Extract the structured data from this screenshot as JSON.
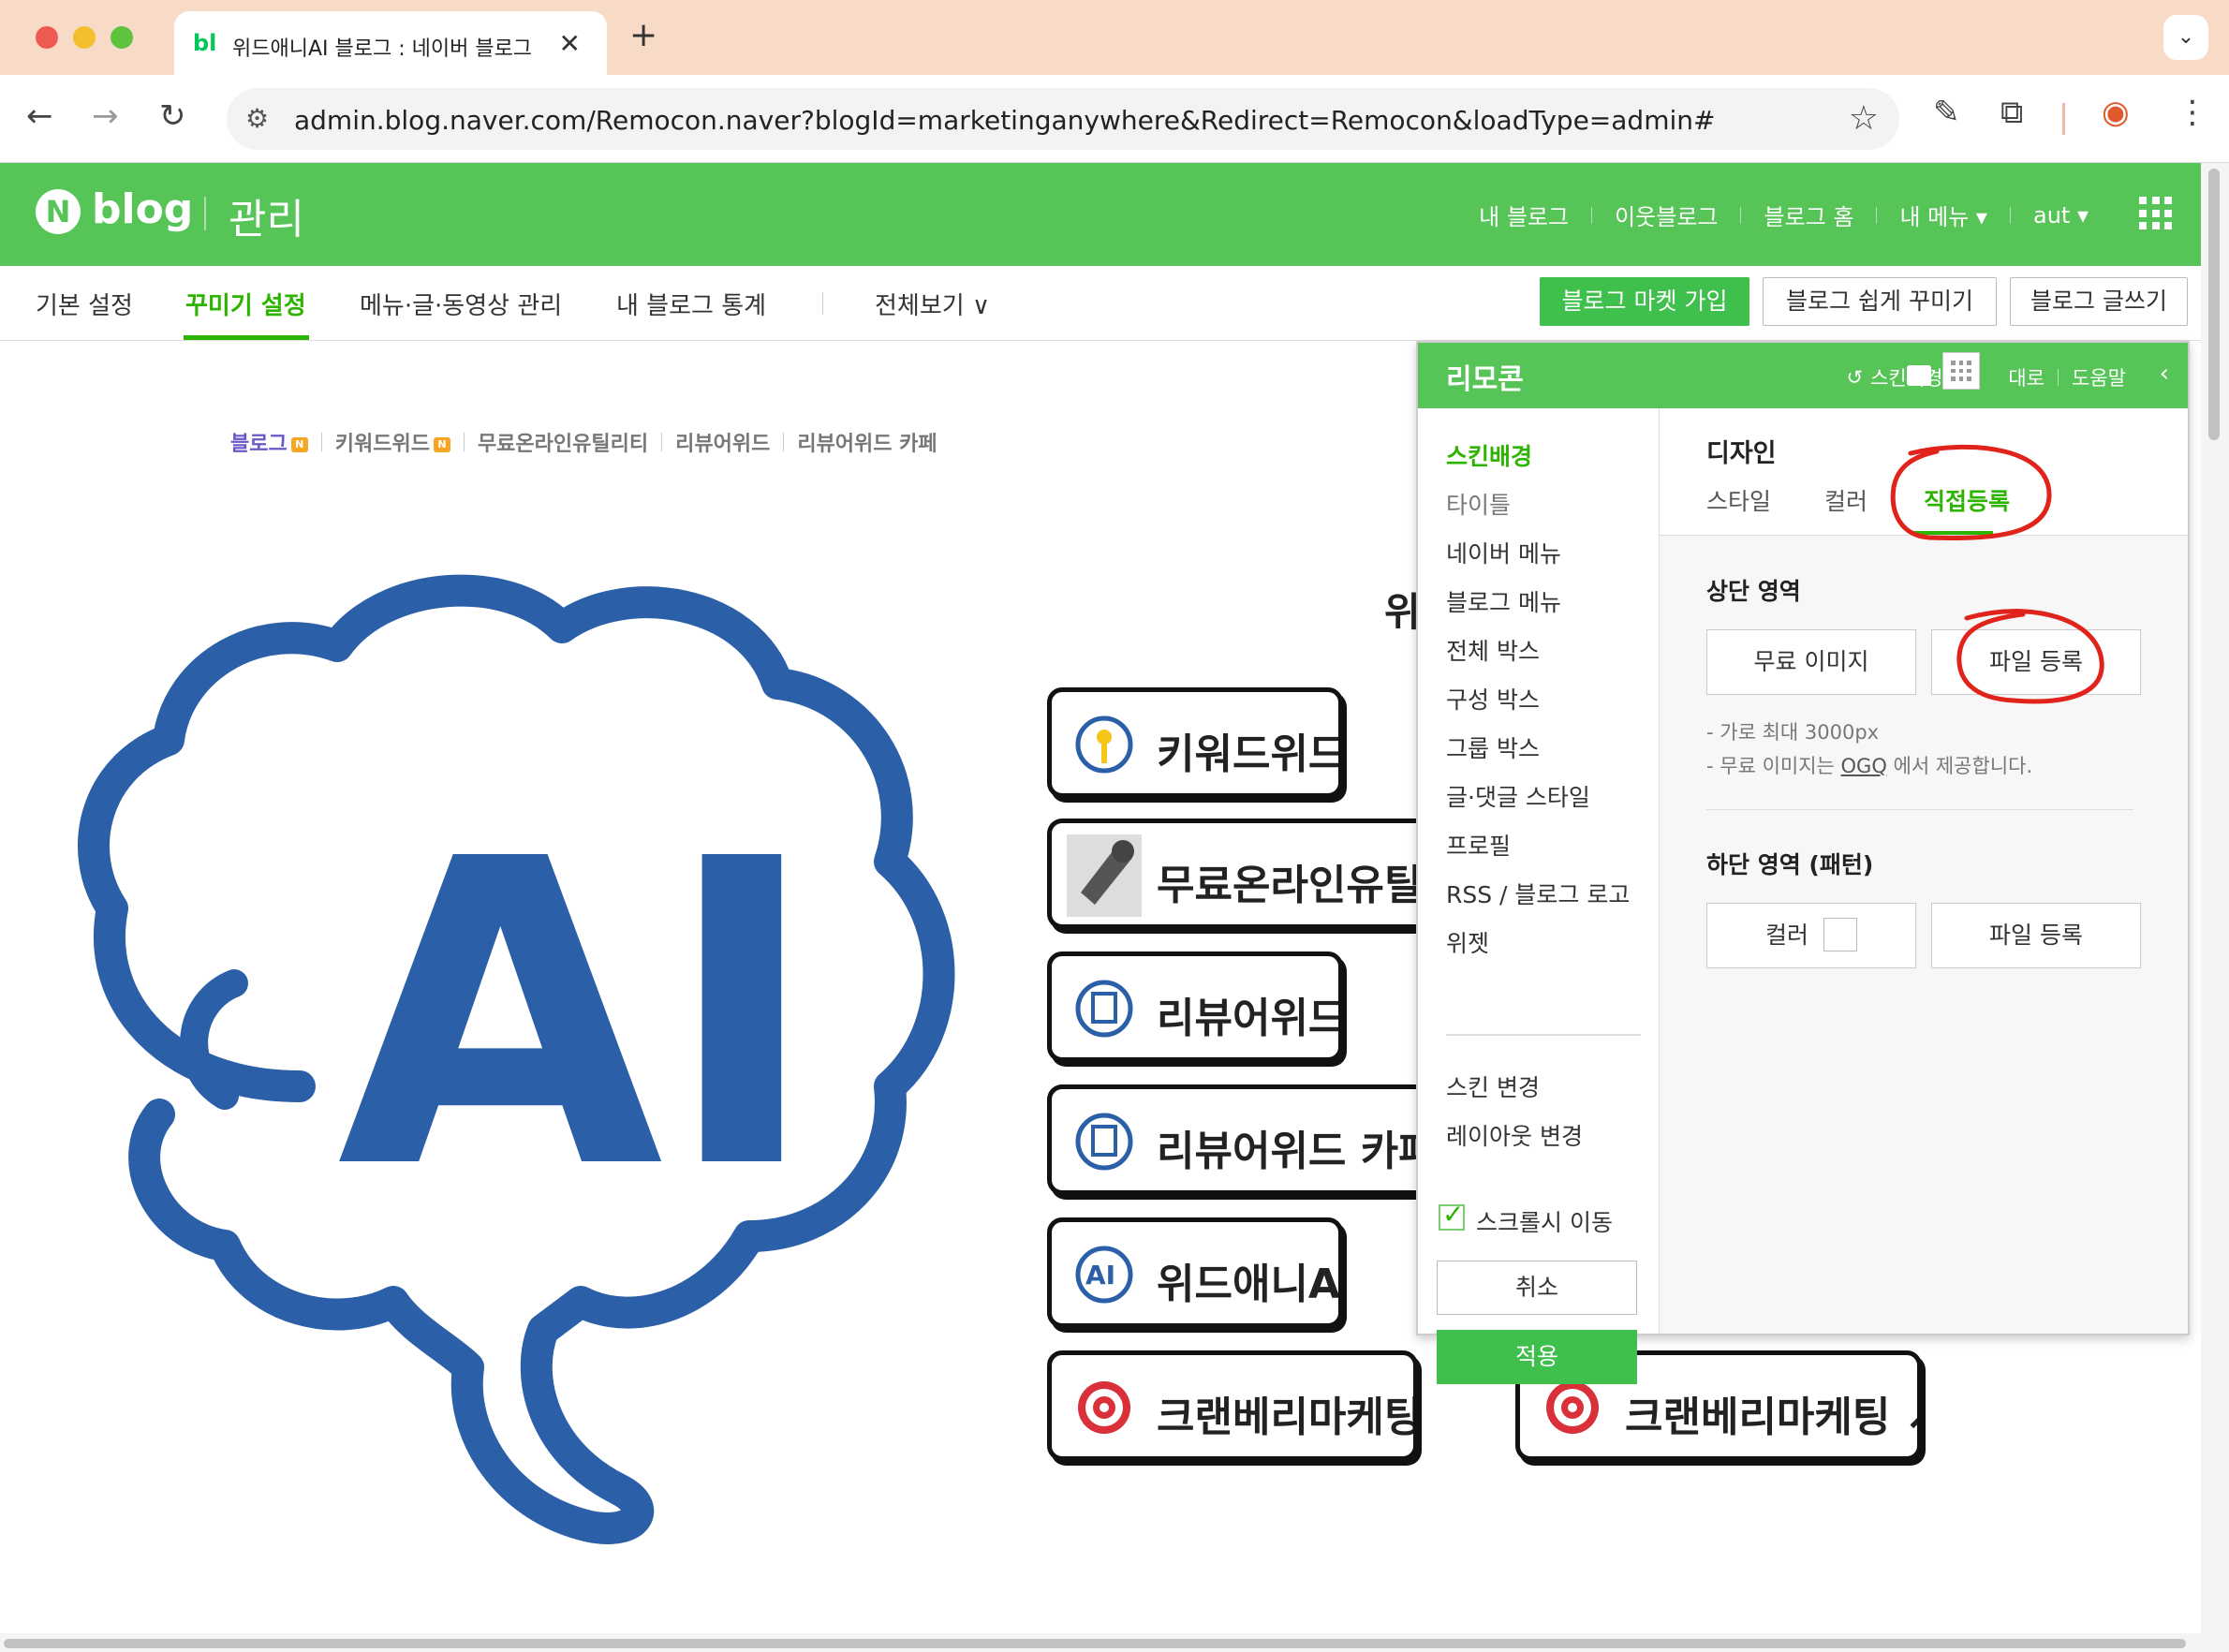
{
  "browser": {
    "tab_favicon": "bl",
    "tab_title": "위드애니AI 블로그 : 네이버 블로그",
    "tab_close": "✕",
    "new_tab": "+",
    "tab_menu": "⌄",
    "url_host": "admin.blog.naver.com",
    "url_rest": "/Remocon.naver?blogId=marketinganywhere&Redirect=Remocon&loadType=admin#",
    "icons": [
      "back-icon",
      "forward-icon",
      "reload-icon",
      "site-settings-icon",
      "bookmark-star-icon",
      "pen-extension-icon",
      "puzzle-extension-icon",
      "profile-icon",
      "more-icon"
    ]
  },
  "header": {
    "logo_letter": "N",
    "blog_word": "blog",
    "admin_word": "관리",
    "links": [
      "내 블로그",
      "이웃블로그",
      "블로그 홈",
      "내 메뉴 ▾",
      "aut ▾"
    ]
  },
  "subnav": {
    "items": [
      "기본 설정",
      "꾸미기 설정",
      "메뉴·글·동영상 관리",
      "내 블로그 통계",
      "전체보기 ∨"
    ],
    "active_index": 1,
    "buttons": [
      "블로그 마켓 가입",
      "블로그 쉽게 꾸미기",
      "블로그 글쓰기"
    ]
  },
  "preview": {
    "links": [
      "블로그",
      "키워드위드",
      "무료온라인유틸리티",
      "리뷰어위드",
      "리뷰어위드 카페"
    ],
    "badge": "N",
    "partial_title": "위",
    "logo_text": "AI",
    "pills": [
      "키워드위드",
      "무료온라인유틸리",
      "리뷰어위드",
      "리뷰어위드 카페",
      "위드애니AI",
      "크랜베리마케팅",
      "크랜베리마케팅 ↗"
    ]
  },
  "remocon": {
    "title": "리모콘",
    "tools": [
      "스킨배경",
      "대로",
      "도움말"
    ],
    "collapse": "‹",
    "side_items": [
      "스킨배경",
      "타이틀",
      "네이버 메뉴",
      "블로그 메뉴",
      "전체 박스",
      "구성 박스",
      "그룹 박스",
      "글·댓글 스타일",
      "프로필",
      "RSS / 블로그 로고",
      "위젯"
    ],
    "side_items_2": [
      "스킨 변경",
      "레이아웃 변경"
    ],
    "scroll_move": "스크롤시 이동",
    "scroll_move_checked": true,
    "cancel": "취소",
    "apply": "적용",
    "design_title": "디자인",
    "tabs": [
      "스타일",
      "컬러",
      "직접등록"
    ],
    "active_tab": 2,
    "top_area_title": "상단 영역",
    "top_buttons": [
      "무료 이미지",
      "파일 등록"
    ],
    "notes": [
      "- 가로 최대 3000px",
      "- 무료 이미지는 ",
      "OGQ",
      " 에서 제공합니다."
    ],
    "bottom_area_title": "하단 영역 (패턴)",
    "bottom_buttons": [
      "컬러",
      "파일 등록"
    ]
  },
  "colors": {
    "naver_green": "#56c457",
    "accent_green": "#2db400",
    "brain_blue": "#2b5fa8",
    "annotation_red": "#e0231b"
  }
}
